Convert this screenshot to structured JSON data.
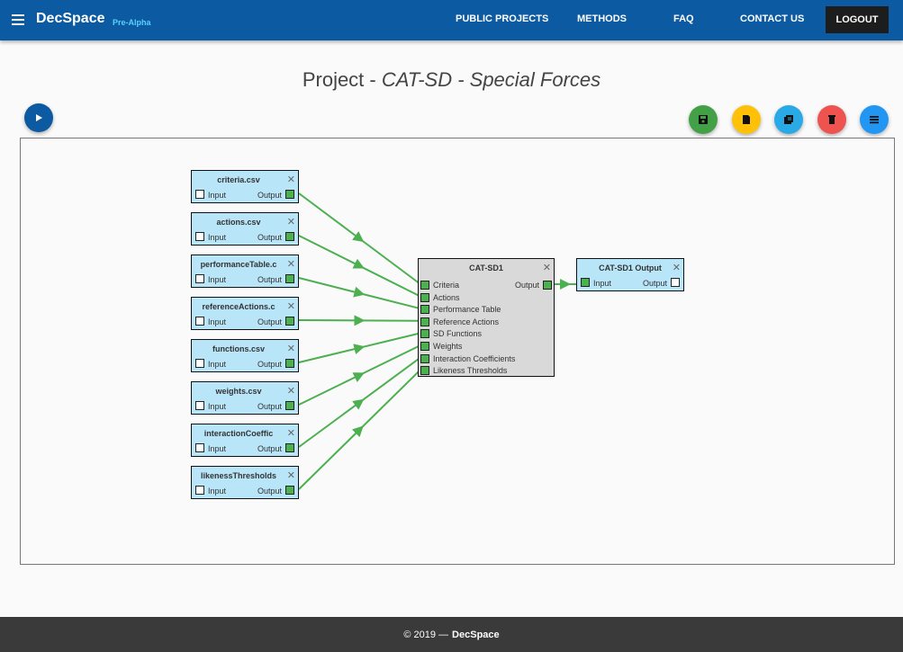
{
  "header": {
    "brand": "DecSpace",
    "brand_sub": "Pre-Alpha",
    "nav": [
      "PUBLIC PROJECTS",
      "METHODS",
      "FAQ",
      "CONTACT US"
    ],
    "logout": "LOGOUT",
    "colors": {
      "bar": "#0b5aa2",
      "logout_bg": "#1d1d1d",
      "brand_sub": "#5ad1ff"
    }
  },
  "title": {
    "prefix": "Project - ",
    "name": "CAT-SD - Special Forces"
  },
  "actions": {
    "run_icon": "play-icon",
    "buttons": [
      {
        "icon": "save-icon",
        "color": "#43a047"
      },
      {
        "icon": "file-icon",
        "color": "#ffc107"
      },
      {
        "icon": "copy-icon",
        "color": "#29a9e6"
      },
      {
        "icon": "delete-icon",
        "color": "#ef5350"
      },
      {
        "icon": "menu-icon",
        "color": "#2196f3"
      }
    ]
  },
  "input_nodes": [
    {
      "title": "criteria.csv",
      "input": "Input",
      "output": "Output"
    },
    {
      "title": "actions.csv",
      "input": "Input",
      "output": "Output"
    },
    {
      "title": "performanceTable.c",
      "input": "Input",
      "output": "Output"
    },
    {
      "title": "referenceActions.c",
      "input": "Input",
      "output": "Output"
    },
    {
      "title": "functions.csv",
      "input": "Input",
      "output": "Output"
    },
    {
      "title": "weights.csv",
      "input": "Input",
      "output": "Output"
    },
    {
      "title": "interactionCoeffic",
      "input": "Input",
      "output": "Output"
    },
    {
      "title": "likenessThresholds",
      "input": "Input",
      "output": "Output"
    }
  ],
  "method_node": {
    "title": "CAT-SD1",
    "output": "Output",
    "inputs": [
      "Criteria",
      "Actions",
      "Performance Table",
      "Reference Actions",
      "SD Functions",
      "Weights",
      "Interaction Coefficients",
      "Likeness Thresholds"
    ]
  },
  "output_node": {
    "title": "CAT-SD1 Output",
    "input": "Input",
    "output": "Output"
  },
  "wire_color": "#4caf50",
  "footer": {
    "text": "© 2019 —",
    "brand": "DecSpace"
  }
}
